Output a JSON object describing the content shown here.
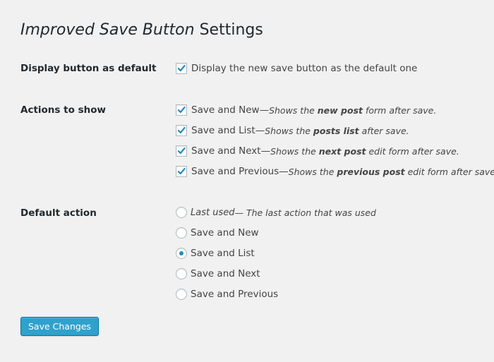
{
  "page": {
    "title_italic": "Improved Save Button",
    "title_rest": " Settings"
  },
  "display_default": {
    "label": "Display button as default",
    "option_label": "Display the new save button as the default one",
    "checked": true
  },
  "actions": {
    "label": "Actions to show",
    "items": [
      {
        "label": "Save and New",
        "sep": " — ",
        "desc_pre": "Shows the ",
        "desc_bold": "new post",
        "desc_post": " form after save.",
        "checked": true
      },
      {
        "label": "Save and List",
        "sep": " — ",
        "desc_pre": "Shows the ",
        "desc_bold": "posts list",
        "desc_post": " after save.",
        "checked": true
      },
      {
        "label": "Save and Next",
        "sep": " — ",
        "desc_pre": "Shows the ",
        "desc_bold": "next post",
        "desc_post": " edit form after save.",
        "checked": true
      },
      {
        "label": "Save and Previous",
        "sep": " — ",
        "desc_pre": "Shows the ",
        "desc_bold": "previous post",
        "desc_post": " edit form after save.",
        "checked": true
      }
    ]
  },
  "default_action": {
    "label": "Default action",
    "options": [
      {
        "label": "Last used",
        "desc": " — The last action that was used",
        "selected": false
      },
      {
        "label": "Save and New",
        "selected": false
      },
      {
        "label": "Save and List",
        "selected": true
      },
      {
        "label": "Save and Next",
        "selected": false
      },
      {
        "label": "Save and Previous",
        "selected": false
      }
    ]
  },
  "submit": {
    "label": "Save Changes"
  },
  "colors": {
    "background": "#f1f1f1",
    "accent": "#1e8cbe",
    "button": "#2ea2cc"
  }
}
